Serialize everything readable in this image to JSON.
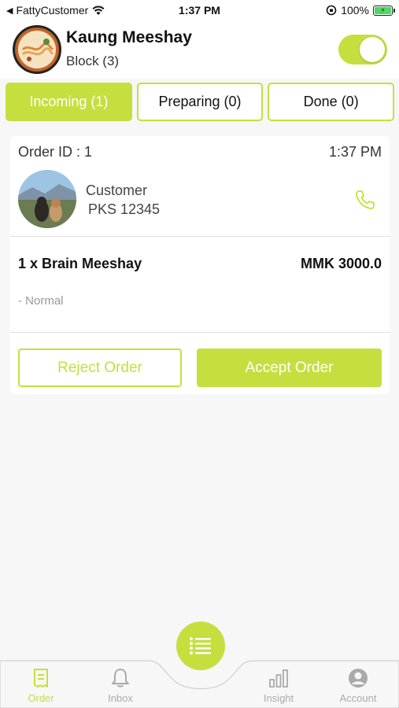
{
  "status_bar": {
    "back_app": "FattyCustomer",
    "time": "1:37 PM",
    "battery": "100%"
  },
  "header": {
    "shop_name": "Kaung Meeshay",
    "shop_block": "Block (3)",
    "online_toggle": true
  },
  "tabs": [
    {
      "label": "Incoming (1)",
      "active": true
    },
    {
      "label": "Preparing (0)",
      "active": false
    },
    {
      "label": "Done (0)",
      "active": false
    }
  ],
  "order": {
    "order_id": "Order ID : 1",
    "time": "1:37 PM",
    "customer_label": "Customer",
    "customer_code": "PKS 12345",
    "item_name": "1 x Brain Meeshay",
    "item_price": "MMK 3000.0",
    "item_note": "- Normal",
    "reject_label": "Reject Order",
    "accept_label": "Accept Order"
  },
  "bottom_nav": {
    "items": [
      {
        "label": "Order",
        "icon": "receipt-icon",
        "active": true
      },
      {
        "label": "Inbox",
        "icon": "bell-icon",
        "active": false
      },
      {
        "label": "Insight",
        "icon": "bar-chart-icon",
        "active": false
      },
      {
        "label": "Account",
        "icon": "account-icon",
        "active": false
      }
    ],
    "center_icon": "list-icon"
  },
  "colors": {
    "accent": "#c6df3f",
    "background": "#f7f7f7",
    "card": "#ffffff"
  }
}
